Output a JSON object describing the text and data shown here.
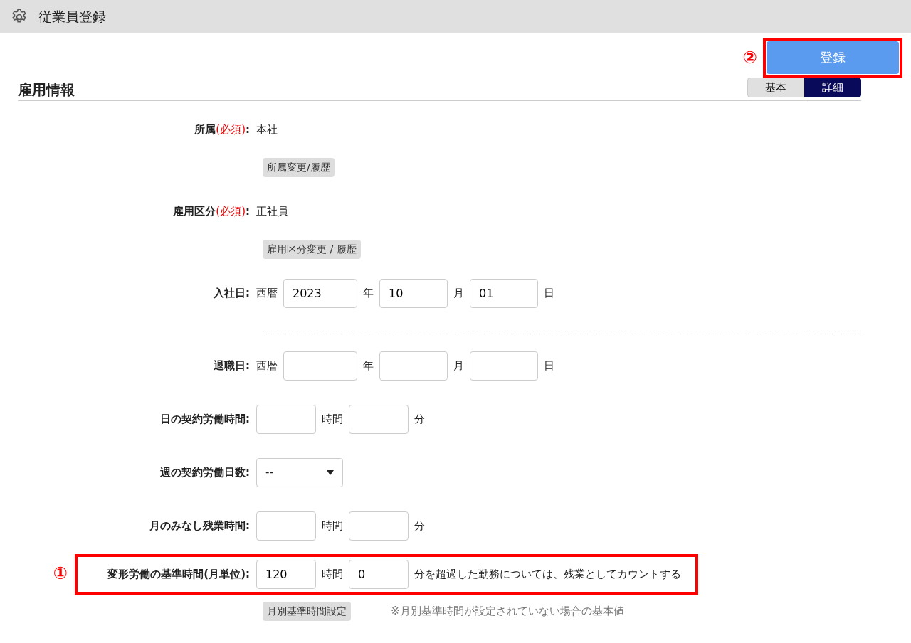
{
  "header": {
    "title": "従業員登録"
  },
  "register": {
    "callout": "②",
    "label": "登録"
  },
  "section": {
    "title": "雇用情報"
  },
  "view_toggle": [
    {
      "label": "基本",
      "selected": false
    },
    {
      "label": "詳細",
      "selected": true
    }
  ],
  "fields": [
    {
      "kind": "text",
      "label": "所属",
      "required_mark": "(必須)",
      "label_end": ":",
      "value": "本社",
      "button": "所属変更/履歴"
    },
    {
      "kind": "text",
      "label": "雇用区分",
      "required_mark": "(必須)",
      "label_end": ":",
      "value": "正社員",
      "button": "雇用区分変更 / 履歴"
    },
    {
      "kind": "date",
      "label": "入社日:",
      "prefix": "西暦",
      "parts": [
        {
          "value": "2023",
          "unit": "年"
        },
        {
          "value": "10",
          "unit": "月"
        },
        {
          "value": "01",
          "unit": "日"
        }
      ]
    },
    {
      "kind": "divider"
    },
    {
      "kind": "date",
      "label": "退職日:",
      "prefix": "西暦",
      "parts": [
        {
          "unit": "年"
        },
        {
          "unit": "月"
        },
        {
          "unit": "日"
        }
      ]
    },
    {
      "kind": "time",
      "label": "日の契約労働時間:",
      "parts": [
        {
          "unit": "時間"
        },
        {
          "unit": "分"
        }
      ]
    },
    {
      "kind": "select",
      "label": "週の契約労働日数:",
      "value": "--"
    },
    {
      "kind": "time",
      "label": "月のみなし残業時間:",
      "parts": [
        {
          "unit": "時間"
        },
        {
          "unit": "分"
        }
      ]
    },
    {
      "kind": "time",
      "label": "変形労働の基準時間(月単位):",
      "callout": "①",
      "parts": [
        {
          "value": "120",
          "unit": "時間"
        },
        {
          "value": "0",
          "unit": "分を超過した勤務については、残業としてカウントする"
        }
      ],
      "button": "月別基準時間設定",
      "note": "※月別基準時間が設定されていない場合の基本値"
    }
  ]
}
